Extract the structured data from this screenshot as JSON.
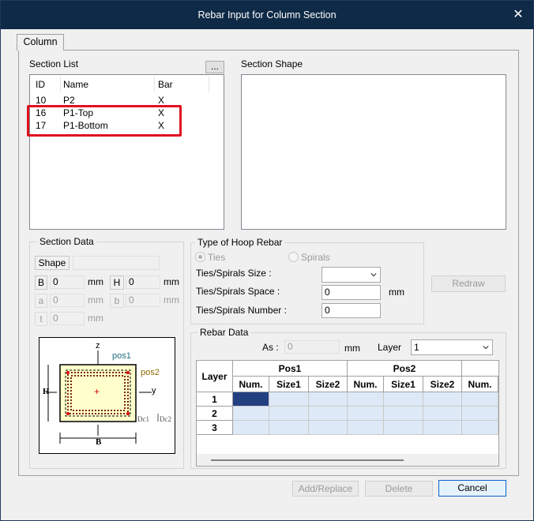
{
  "window": {
    "title": "Rebar Input for Column Section"
  },
  "tab": {
    "label": "Column"
  },
  "section_list": {
    "title": "Section List",
    "browse_label": "...",
    "columns": [
      "ID",
      "Name",
      "Bar"
    ],
    "rows": [
      {
        "id": "10",
        "name": "P2",
        "bar": "X"
      },
      {
        "id": "16",
        "name": "P1-Top",
        "bar": "X"
      },
      {
        "id": "17",
        "name": "P1-Bottom",
        "bar": "X"
      }
    ]
  },
  "section_shape": {
    "title": "Section Shape"
  },
  "section_data": {
    "title": "Section Data",
    "shape_label": "Shape",
    "shape_value": "",
    "b_label": "B",
    "b_value": "0",
    "b_unit": "mm",
    "h_label": "H",
    "h_value": "0",
    "h_unit": "mm",
    "a_label": "a",
    "a_value": "0",
    "a_unit": "mm",
    "bb_label": "b",
    "bb_value": "0",
    "bb_unit": "mm",
    "t_label": "t",
    "t_value": "0",
    "t_unit": "mm"
  },
  "diagram": {
    "z": "z",
    "y": "y",
    "pos1": "pos1",
    "pos2": "pos2",
    "H": "H",
    "B": "B",
    "plus": "+",
    "dc": "Dc1",
    "dc2": "Dc2"
  },
  "hoop": {
    "title": "Type of Hoop Rebar",
    "ties_label": "Ties",
    "spirals_label": "Spirals",
    "size_label": "Ties/Spirals Size :",
    "size_value": "",
    "space_label": "Ties/Spirals Space :",
    "space_value": "0",
    "space_unit": "mm",
    "number_label": "Ties/Spirals Number :",
    "number_value": "0"
  },
  "redraw_label": "Redraw",
  "rebar_data": {
    "title": "Rebar Data",
    "as_label": "As :",
    "as_value": "0",
    "as_unit": "mm",
    "layer_label": "Layer",
    "layer_value": "1",
    "grid": {
      "layer_header": "Layer",
      "groups": [
        "Pos1",
        "Pos2",
        ""
      ],
      "subheaders": [
        "Num.",
        "Size1",
        "Size2",
        "Num.",
        "Size1",
        "Size2",
        "Num."
      ],
      "rows": [
        "1",
        "2",
        "3"
      ]
    }
  },
  "buttons": {
    "add_replace": "Add/Replace",
    "delete": "Delete",
    "cancel": "Cancel"
  }
}
